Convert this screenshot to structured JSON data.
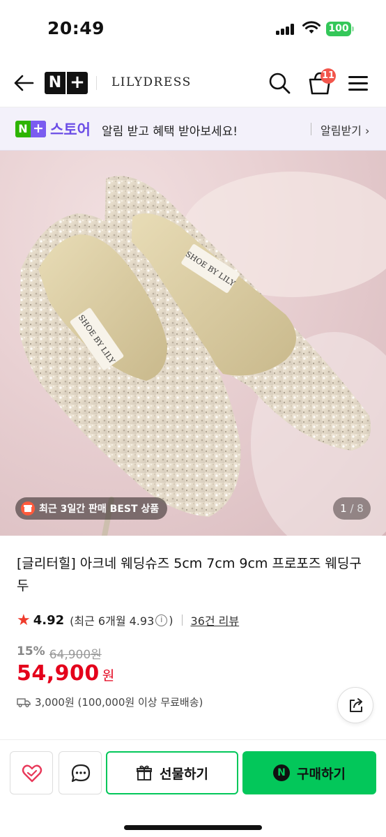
{
  "status_bar": {
    "time": "20:49",
    "battery": "100"
  },
  "header": {
    "brand": "LILYDRESS",
    "platform_logo_n": "N",
    "platform_logo_plus": "+",
    "cart_count": "11",
    "icons": [
      "back-arrow-icon",
      "search-icon",
      "cart-icon",
      "hamburger-menu-icon"
    ]
  },
  "store_banner": {
    "logo_n": "N",
    "logo_plus": "+",
    "store_name": "스토어",
    "message": "알림 받고 혜택 받아보세요!",
    "notify_label": "알림받기 ›"
  },
  "gallery": {
    "best_badge": "최근 3일간 판매 BEST 상품",
    "current_page": "1",
    "page_separator": " / ",
    "total_pages": "8"
  },
  "product": {
    "title": "[글리터힐] 아크네 웨딩슈즈 5cm 7cm 9cm 프로포즈 웨딩구두",
    "rating": "4.92",
    "recent_rating": "(최근 6개월 4.93",
    "info_glyph": "i",
    "recent_rating_close": ")",
    "review_count": "36건 리뷰",
    "discount_percent": "15%",
    "original_price": "64,900원",
    "price": "54,900",
    "price_unit": "원",
    "shipping": "3,000원 (100,000원 이상 무료배송)",
    "insole_text": "SHOE BY LILY"
  },
  "bottom_bar": {
    "gift_label": "선물하기",
    "buy_label": "구매하기",
    "npay_glyph": "N"
  },
  "colors": {
    "naver_green": "#03c75a",
    "price_red": "#e4001b",
    "store_purple": "#6b4de6",
    "star_red": "#ef3b2c"
  }
}
